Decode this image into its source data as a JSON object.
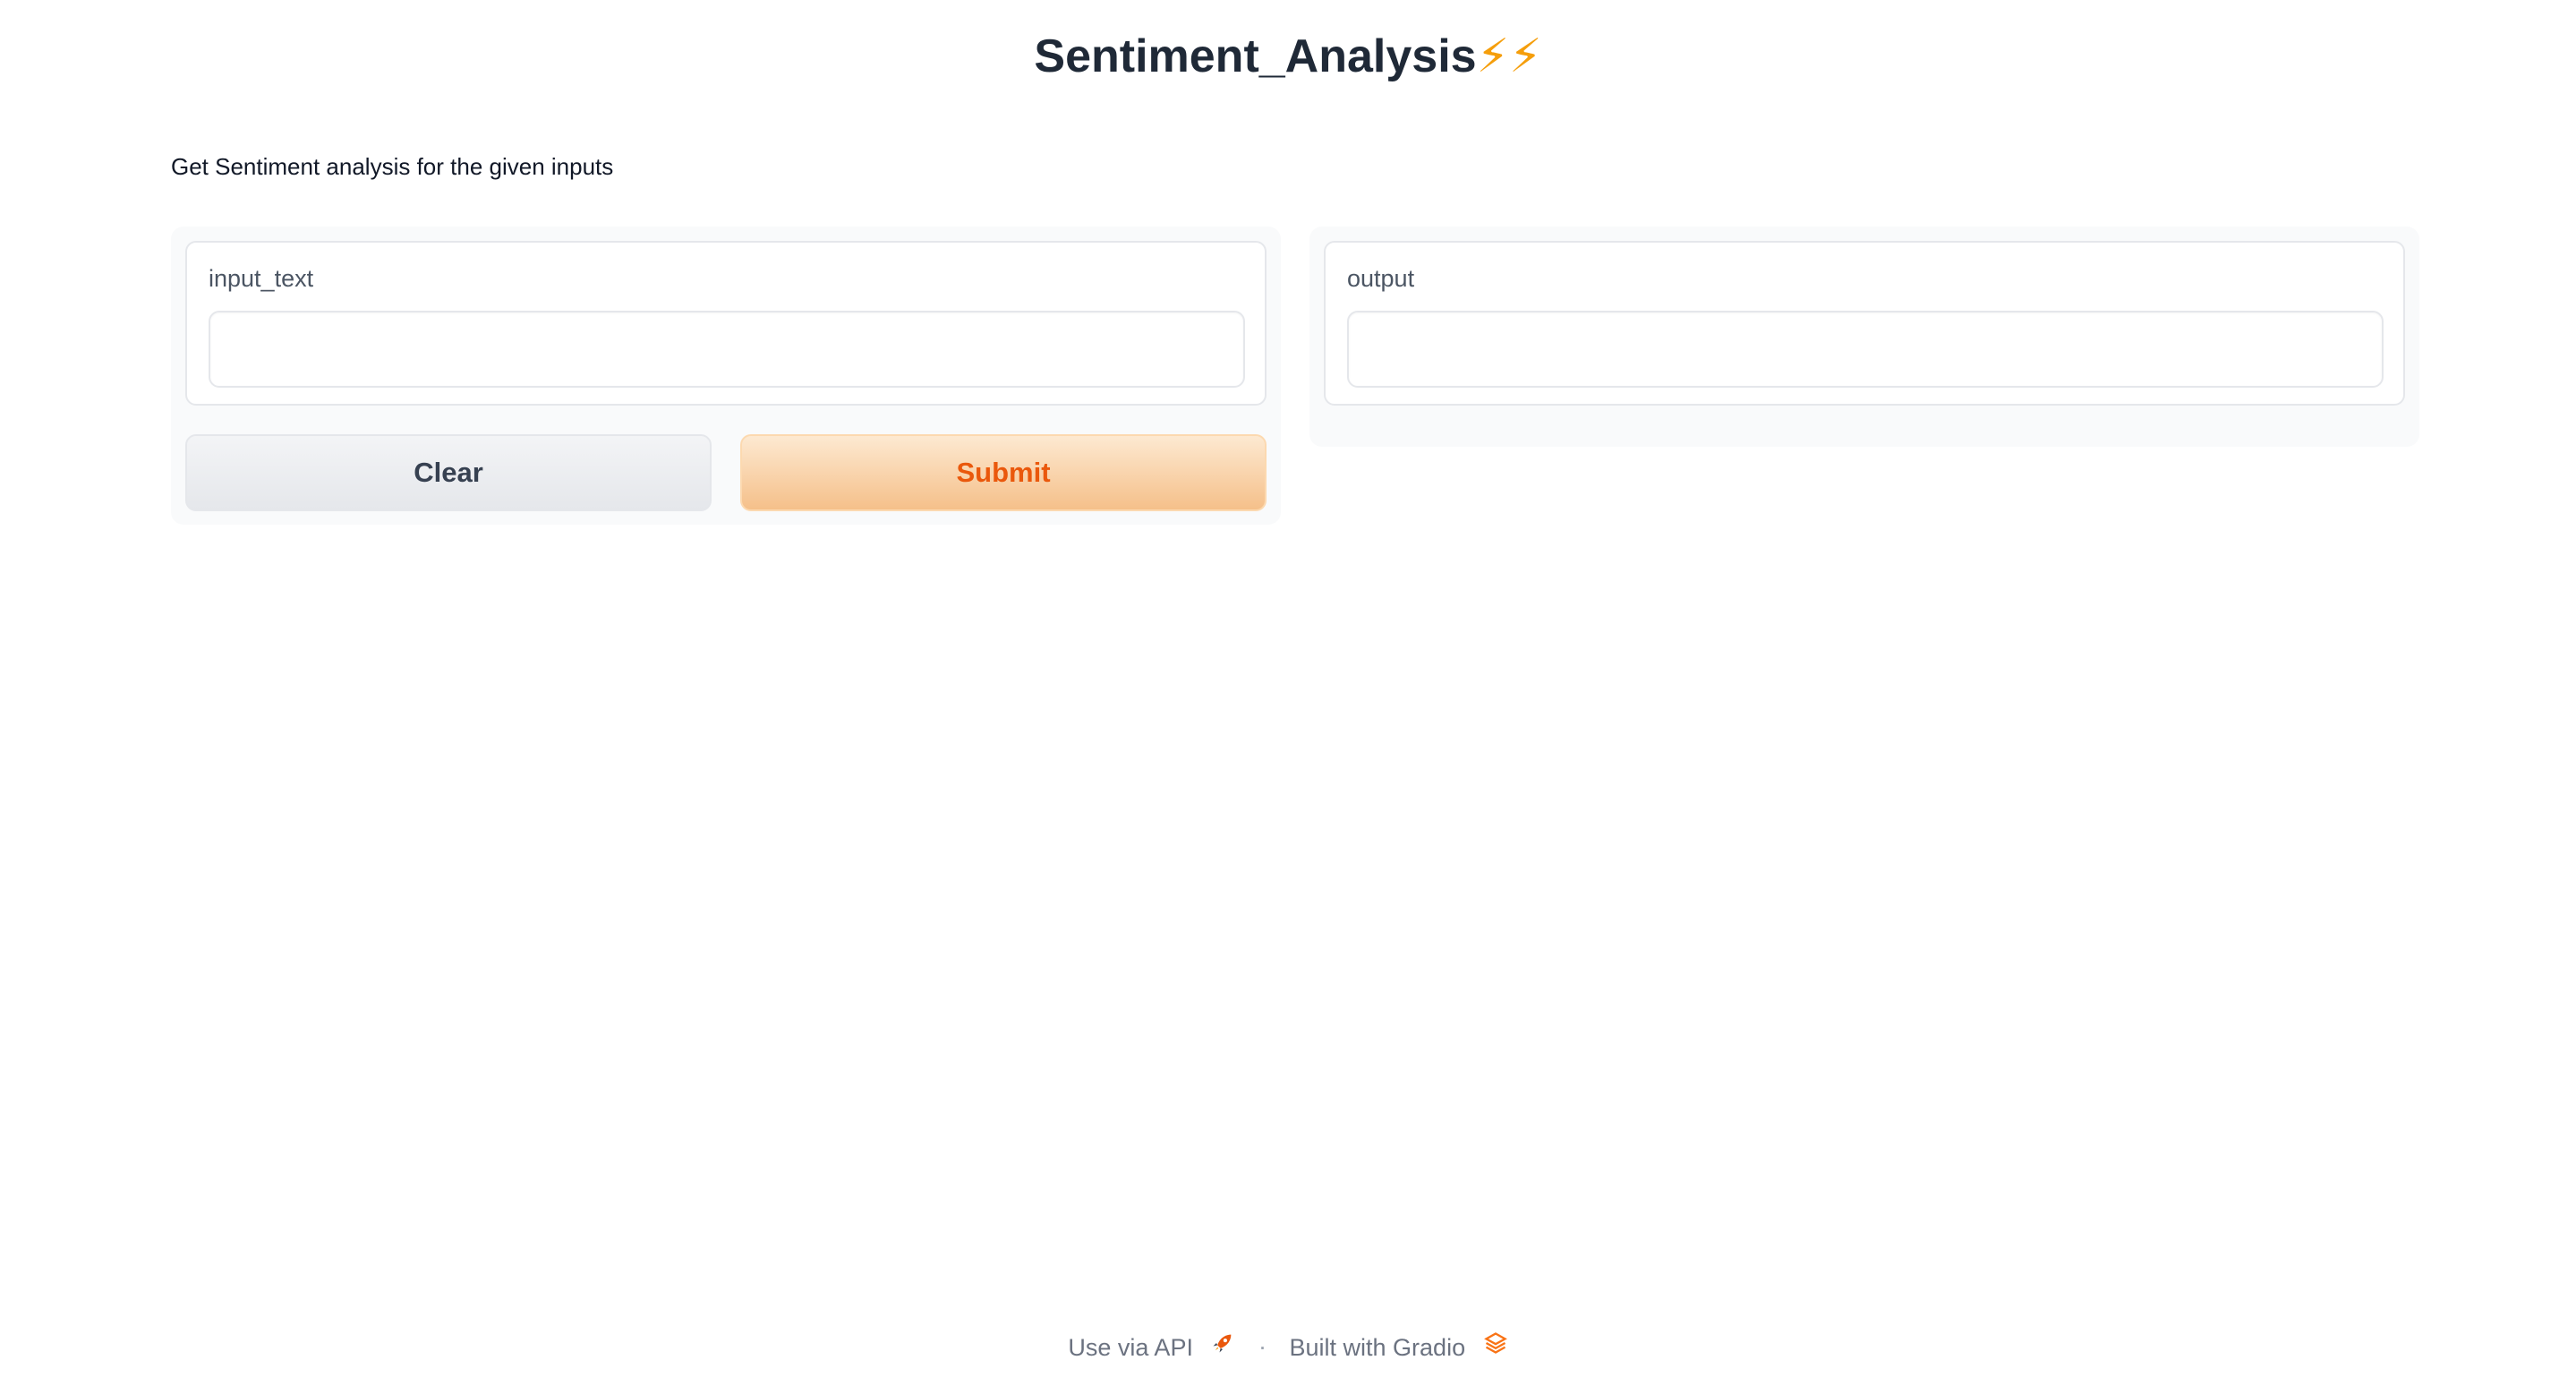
{
  "header": {
    "title": "Sentiment_Analysis",
    "title_emoji": "⚡⚡",
    "emoji_color": "#f59e0b"
  },
  "description": "Get Sentiment analysis for the given inputs",
  "inputs": {
    "input_text": {
      "label": "input_text",
      "value": "",
      "placeholder": ""
    }
  },
  "outputs": {
    "output": {
      "label": "output",
      "value": ""
    }
  },
  "buttons": {
    "clear_label": "Clear",
    "submit_label": "Submit"
  },
  "footer": {
    "api_label": "Use via API",
    "api_icon": "rocket-icon",
    "separator": "·",
    "built_label": "Built with Gradio",
    "built_icon": "gradio-logo-icon"
  },
  "colors": {
    "accent": "#ea580c",
    "submit_gradient_top": "#fde9d1",
    "submit_gradient_bottom": "#f5c08a"
  }
}
